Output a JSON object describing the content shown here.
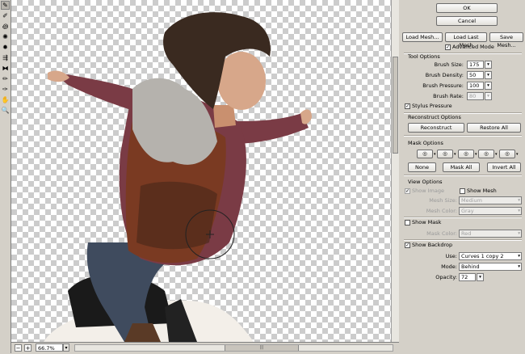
{
  "tools": [
    {
      "name": "forward-warp-tool-icon",
      "glyph": "✎"
    },
    {
      "name": "reconstruct-tool-icon",
      "glyph": "✐"
    },
    {
      "name": "twirl-clockwise-tool-icon",
      "glyph": "꩜"
    },
    {
      "name": "pucker-tool-icon",
      "glyph": "✺"
    },
    {
      "name": "bloat-tool-icon",
      "glyph": "✹"
    },
    {
      "name": "push-left-tool-icon",
      "glyph": "⇶"
    },
    {
      "name": "mirror-tool-icon",
      "glyph": "⧓"
    },
    {
      "name": "freeze-mask-tool-icon",
      "glyph": "✏"
    },
    {
      "name": "thaw-mask-tool-icon",
      "glyph": "✑"
    },
    {
      "name": "hand-tool-icon",
      "glyph": "✋"
    },
    {
      "name": "zoom-tool-icon",
      "glyph": "🔍"
    }
  ],
  "buttons": {
    "ok": "OK",
    "cancel": "Cancel",
    "load_mesh": "Load Mesh...",
    "load_last_mesh": "Load Last Mesh",
    "save_mesh": "Save Mesh..."
  },
  "advanced_mode": {
    "label": "Advanced Mode",
    "checked": true
  },
  "tool_options": {
    "title": "Tool Options",
    "brush_size": {
      "label": "Brush Size:",
      "value": "175"
    },
    "brush_density": {
      "label": "Brush Density:",
      "value": "50"
    },
    "brush_pressure": {
      "label": "Brush Pressure:",
      "value": "100"
    },
    "brush_rate": {
      "label": "Brush Rate:",
      "value": "80"
    },
    "stylus_pressure": {
      "label": "Stylus Pressure",
      "checked": true
    }
  },
  "reconstruct_options": {
    "title": "Reconstruct Options",
    "reconstruct": "Reconstruct",
    "restore_all": "Restore All"
  },
  "mask_options": {
    "title": "Mask Options",
    "none": "None",
    "mask_all": "Mask All",
    "invert_all": "Invert All"
  },
  "view_options": {
    "title": "View Options",
    "show_image": "Show Image",
    "show_mesh": "Show Mesh",
    "mesh_size": {
      "label": "Mesh Size:",
      "value": "Medium"
    },
    "mesh_color": {
      "label": "Mesh Color:",
      "value": "Gray"
    },
    "show_mask": "Show Mask",
    "mask_color": {
      "label": "Mask Color:",
      "value": "Red"
    },
    "show_backdrop": "Show Backdrop",
    "use": {
      "label": "Use:",
      "value": "Curves 1 copy 2"
    },
    "mode": {
      "label": "Mode:",
      "value": "Behind"
    },
    "opacity": {
      "label": "Opacity:",
      "value": "72"
    }
  },
  "status": {
    "zoom": "66.7%",
    "minus": "−",
    "plus": "+"
  },
  "colors": {
    "panel_bg": "#d4d0c8",
    "sweater": "#7a3b45",
    "vest": "#7a3a22",
    "jeans": "#3f4b5e",
    "fur": "#b5b2ad"
  }
}
